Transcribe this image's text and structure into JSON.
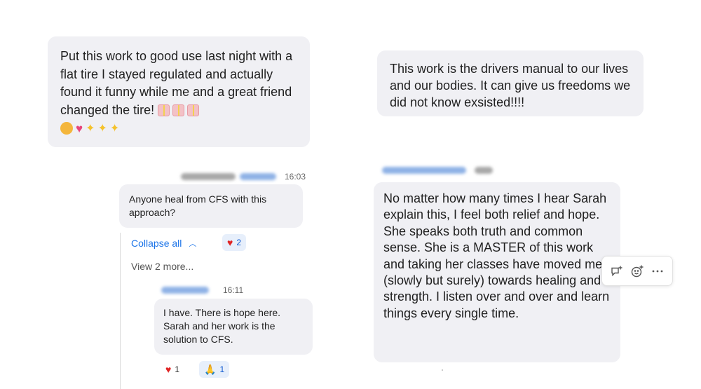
{
  "messages": {
    "m1": {
      "text": "Put this work to good use last night with a flat tire I stayed regulated and actually found it funny while me and a great friend changed the tire!",
      "emojis": [
        "gift",
        "gift",
        "gift",
        "raising-hands",
        "sparkling-heart",
        "sparkles",
        "sparkles",
        "sparkles"
      ]
    },
    "m2": {
      "text": "This work is the drivers manual to our lives and our bodies. It can give us freedoms we did not know exsisted!!!!"
    },
    "m3": {
      "time": "16:03",
      "text": "Anyone heal from CFS with this approach?",
      "reactions": [
        {
          "emoji": "heart",
          "count": "2"
        }
      ]
    },
    "m3_thread": {
      "collapse_label": "Collapse all",
      "view_more": "View 2 more..."
    },
    "m4": {
      "time": "16:11",
      "text": "I have. There is hope here. Sarah and her work is the solution to CFS.",
      "reactions": [
        {
          "emoji": "heart",
          "count": "1"
        },
        {
          "emoji": "folded-hands",
          "count": "1"
        }
      ]
    },
    "m5": {
      "text": "No matter how many times I hear Sarah explain this, I feel both relief and hope. She speaks both truth and common sense. She is a MASTER of this work and taking her classes have moved me (slowly but surely) towards healing and strength. I listen over and over and learn things every single time."
    },
    "toolbar": {
      "icons": [
        "reply-thread-icon",
        "add-reaction-icon",
        "more-options-icon"
      ]
    },
    "colors": {
      "bubble": "#f0f0f4",
      "link": "#1a73e8",
      "reaction_bg": "#e7effb"
    }
  }
}
